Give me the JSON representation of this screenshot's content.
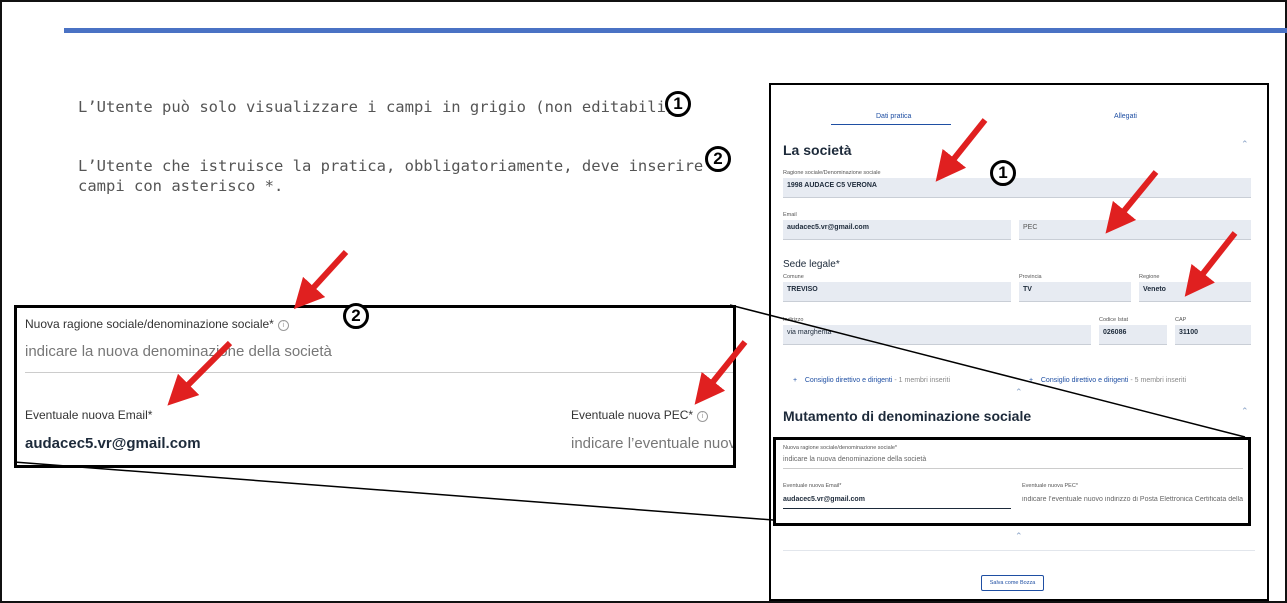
{
  "intro": {
    "line1": "L’Utente può solo visualizzare i campi in grigio (non editabili).",
    "line2a": "L’Utente che istruisce la pratica, obbligatoriamente, deve inserire i",
    "line2b": "campi con asterisco *."
  },
  "markers": {
    "one": "1",
    "two": "2"
  },
  "zoom": {
    "ragione_label": "Nuova ragione sociale/denominazione sociale*",
    "ragione_placeholder": "indicare la nuova denominazione della società",
    "email_label": "Eventuale nuova Email*",
    "email_value": "audacec5.vr@gmail.com",
    "pec_label": "Eventuale nuova PEC*",
    "pec_placeholder": "indicare l’eventuale nuovo indirizzo di Posta Elettronica Certificata della"
  },
  "form": {
    "tabs": [
      "Dati pratica",
      "Allegati"
    ],
    "societa": {
      "title": "La società",
      "ragione_label": "Ragione sociale/Denominazione sociale",
      "ragione_value": "1998 AUDACE C5 VERONA",
      "email_label": "Email",
      "email_value": "audacec5.vr@gmail.com",
      "pec_value": "PEC"
    },
    "sede": {
      "title": "Sede legale*",
      "comune_label": "Comune",
      "comune_value": "TREVISO",
      "provincia_label": "Provincia",
      "provincia_value": "TV",
      "regione_label": "Regione",
      "regione_value": "Veneto",
      "indirizzo_label": "Indirizzo",
      "indirizzo_value": "via margherita",
      "istat_label": "Codice Istat",
      "istat_value": "026086",
      "cap_label": "CAP",
      "cap_value": "31100"
    },
    "consiglio": [
      {
        "label": "Consiglio direttivo e dirigenti",
        "count": "- 1 membri inseriti"
      },
      {
        "label": "Consiglio direttivo e dirigenti",
        "count": "- 5 membri inseriti"
      }
    ],
    "mutamento": {
      "title": "Mutamento di denominazione sociale",
      "ragione_label": "Nuova ragione sociale/denominazione sociale*",
      "ragione_placeholder": "indicare la nuova denominazione della società",
      "email_label": "Eventuale nuova Email*",
      "email_value": "audacec5.vr@gmail.com",
      "pec_label": "Eventuale nuova PEC*",
      "pec_placeholder": "indicare l’eventuale nuovo indirizzo di Posta Elettronica Certificata della"
    },
    "save_button": "Salva come Bozza"
  },
  "colors": {
    "accent": "#4a72c4",
    "arrow": "#e02020",
    "link": "#1f4fa3",
    "readonly_bg": "#e7ebf2"
  },
  "icons": {
    "info": "info-icon",
    "chevron": "chevron-up-icon",
    "plus": "plus-icon"
  }
}
